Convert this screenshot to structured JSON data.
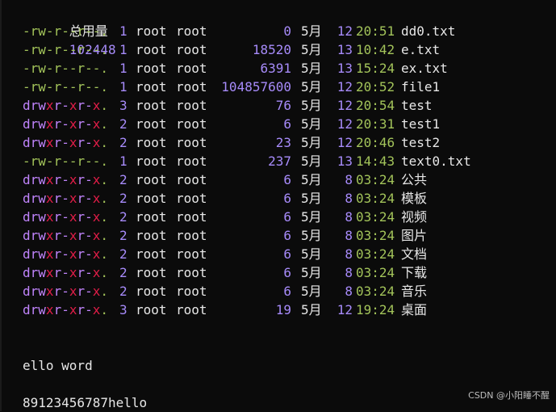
{
  "terminal": {
    "total_label": "总用量",
    "total_value": "102448",
    "entries": [
      {
        "type": "file",
        "perm_parts": [
          "-",
          "r",
          "w",
          "-",
          "r",
          "-",
          "-",
          "r",
          "-",
          "-",
          "."
        ],
        "links": "1",
        "owner": "root",
        "group": "root",
        "size": "0",
        "month": "5月",
        "day": "12",
        "time": "20:51",
        "name": "dd0.txt"
      },
      {
        "type": "file",
        "perm_parts": [
          "-",
          "r",
          "w",
          "-",
          "r",
          "-",
          "-",
          "r",
          "-",
          "-",
          "."
        ],
        "links": "1",
        "owner": "root",
        "group": "root",
        "size": "18520",
        "month": "5月",
        "day": "13",
        "time": "10:42",
        "name": "e.txt"
      },
      {
        "type": "file",
        "perm_parts": [
          "-",
          "r",
          "w",
          "-",
          "r",
          "-",
          "-",
          "r",
          "-",
          "-",
          "."
        ],
        "links": "1",
        "owner": "root",
        "group": "root",
        "size": "6391",
        "month": "5月",
        "day": "13",
        "time": "15:24",
        "name": "ex.txt"
      },
      {
        "type": "file",
        "perm_parts": [
          "-",
          "r",
          "w",
          "-",
          "r",
          "-",
          "-",
          "r",
          "-",
          "-",
          "."
        ],
        "links": "1",
        "owner": "root",
        "group": "root",
        "size": "104857600",
        "month": "5月",
        "day": "12",
        "time": "20:52",
        "name": "file1"
      },
      {
        "type": "dir",
        "perm_parts": [
          "d",
          "r",
          "w",
          "x",
          "r",
          "-",
          "x",
          "r",
          "-",
          "x",
          "."
        ],
        "links": "3",
        "owner": "root",
        "group": "root",
        "size": "76",
        "month": "5月",
        "day": "12",
        "time": "20:54",
        "name": "test"
      },
      {
        "type": "dir",
        "perm_parts": [
          "d",
          "r",
          "w",
          "x",
          "r",
          "-",
          "x",
          "r",
          "-",
          "x",
          "."
        ],
        "links": "2",
        "owner": "root",
        "group": "root",
        "size": "6",
        "month": "5月",
        "day": "12",
        "time": "20:31",
        "name": "test1"
      },
      {
        "type": "dir",
        "perm_parts": [
          "d",
          "r",
          "w",
          "x",
          "r",
          "-",
          "x",
          "r",
          "-",
          "x",
          "."
        ],
        "links": "2",
        "owner": "root",
        "group": "root",
        "size": "23",
        "month": "5月",
        "day": "12",
        "time": "20:46",
        "name": "test2"
      },
      {
        "type": "file",
        "perm_parts": [
          "-",
          "r",
          "w",
          "-",
          "r",
          "-",
          "-",
          "r",
          "-",
          "-",
          "."
        ],
        "links": "1",
        "owner": "root",
        "group": "root",
        "size": "237",
        "month": "5月",
        "day": "13",
        "time": "14:43",
        "name": "text0.txt"
      },
      {
        "type": "dir",
        "perm_parts": [
          "d",
          "r",
          "w",
          "x",
          "r",
          "-",
          "x",
          "r",
          "-",
          "x",
          "."
        ],
        "links": "2",
        "owner": "root",
        "group": "root",
        "size": "6",
        "month": "5月",
        "day": "8",
        "time": "03:24",
        "name": "公共"
      },
      {
        "type": "dir",
        "perm_parts": [
          "d",
          "r",
          "w",
          "x",
          "r",
          "-",
          "x",
          "r",
          "-",
          "x",
          "."
        ],
        "links": "2",
        "owner": "root",
        "group": "root",
        "size": "6",
        "month": "5月",
        "day": "8",
        "time": "03:24",
        "name": "模板"
      },
      {
        "type": "dir",
        "perm_parts": [
          "d",
          "r",
          "w",
          "x",
          "r",
          "-",
          "x",
          "r",
          "-",
          "x",
          "."
        ],
        "links": "2",
        "owner": "root",
        "group": "root",
        "size": "6",
        "month": "5月",
        "day": "8",
        "time": "03:24",
        "name": "视频"
      },
      {
        "type": "dir",
        "perm_parts": [
          "d",
          "r",
          "w",
          "x",
          "r",
          "-",
          "x",
          "r",
          "-",
          "x",
          "."
        ],
        "links": "2",
        "owner": "root",
        "group": "root",
        "size": "6",
        "month": "5月",
        "day": "8",
        "time": "03:24",
        "name": "图片"
      },
      {
        "type": "dir",
        "perm_parts": [
          "d",
          "r",
          "w",
          "x",
          "r",
          "-",
          "x",
          "r",
          "-",
          "x",
          "."
        ],
        "links": "2",
        "owner": "root",
        "group": "root",
        "size": "6",
        "month": "5月",
        "day": "8",
        "time": "03:24",
        "name": "文档"
      },
      {
        "type": "dir",
        "perm_parts": [
          "d",
          "r",
          "w",
          "x",
          "r",
          "-",
          "x",
          "r",
          "-",
          "x",
          "."
        ],
        "links": "2",
        "owner": "root",
        "group": "root",
        "size": "6",
        "month": "5月",
        "day": "8",
        "time": "03:24",
        "name": "下载"
      },
      {
        "type": "dir",
        "perm_parts": [
          "d",
          "r",
          "w",
          "x",
          "r",
          "-",
          "x",
          "r",
          "-",
          "x",
          "."
        ],
        "links": "2",
        "owner": "root",
        "group": "root",
        "size": "6",
        "month": "5月",
        "day": "8",
        "time": "03:24",
        "name": "音乐"
      },
      {
        "type": "dir",
        "perm_parts": [
          "d",
          "r",
          "w",
          "x",
          "r",
          "-",
          "x",
          "r",
          "-",
          "x",
          "."
        ],
        "links": "3",
        "owner": "root",
        "group": "root",
        "size": "19",
        "month": "5月",
        "day": "12",
        "time": "19:24",
        "name": "桌面"
      }
    ],
    "output_lines": [
      "ello word",
      "89123456787hello"
    ],
    "watermark": "CSDN @小阳睡不醒"
  },
  "colors": {
    "background": "#0b0b0b",
    "text": "#e7e7e7",
    "number_purple": "#a78bfa",
    "green": "#a3c45a",
    "dir_magenta": "#c084fc",
    "exec_red": "#e11d48"
  }
}
